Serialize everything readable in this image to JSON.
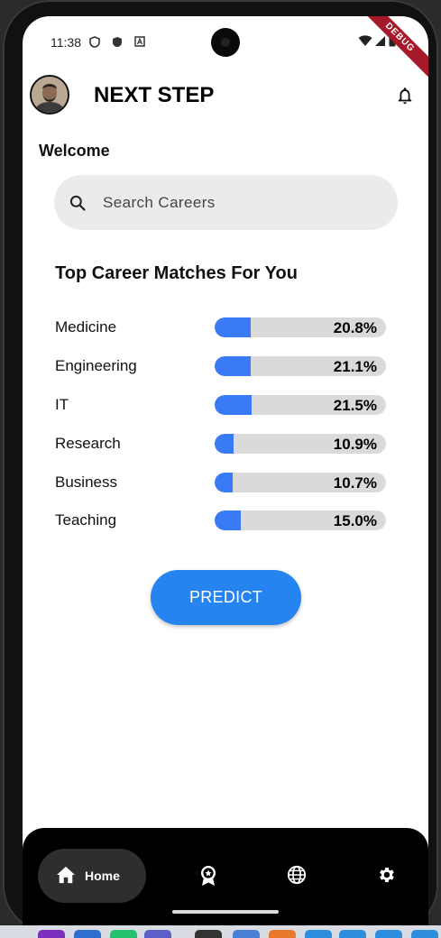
{
  "status_bar": {
    "time": "11:38"
  },
  "debug_banner": "DEBUG",
  "app_bar": {
    "title": "NEXT STEP"
  },
  "welcome": "Welcome",
  "search": {
    "placeholder": "Search Careers"
  },
  "section_title": "Top Career Matches For You",
  "careers": [
    {
      "label": "Medicine",
      "value": "20.8%",
      "fraction": 0.208
    },
    {
      "label": "Engineering",
      "value": "21.1%",
      "fraction": 0.211
    },
    {
      "label": "IT",
      "value": "21.5%",
      "fraction": 0.215
    },
    {
      "label": "Research",
      "value": "10.9%",
      "fraction": 0.109
    },
    {
      "label": "Business",
      "value": "10.7%",
      "fraction": 0.107
    },
    {
      "label": "Teaching",
      "value": "15.0%",
      "fraction": 0.15
    }
  ],
  "predict_label": "PREDICT",
  "bottom_nav": {
    "home_label": "Home",
    "icons": [
      "home-icon",
      "award-icon",
      "globe-icon",
      "gear-icon"
    ]
  },
  "colors": {
    "accent": "#2684f0",
    "bar_fill": "#3a7bf5",
    "bar_track": "#dadada",
    "nav_bg": "#000000",
    "debug": "#a5192a"
  }
}
